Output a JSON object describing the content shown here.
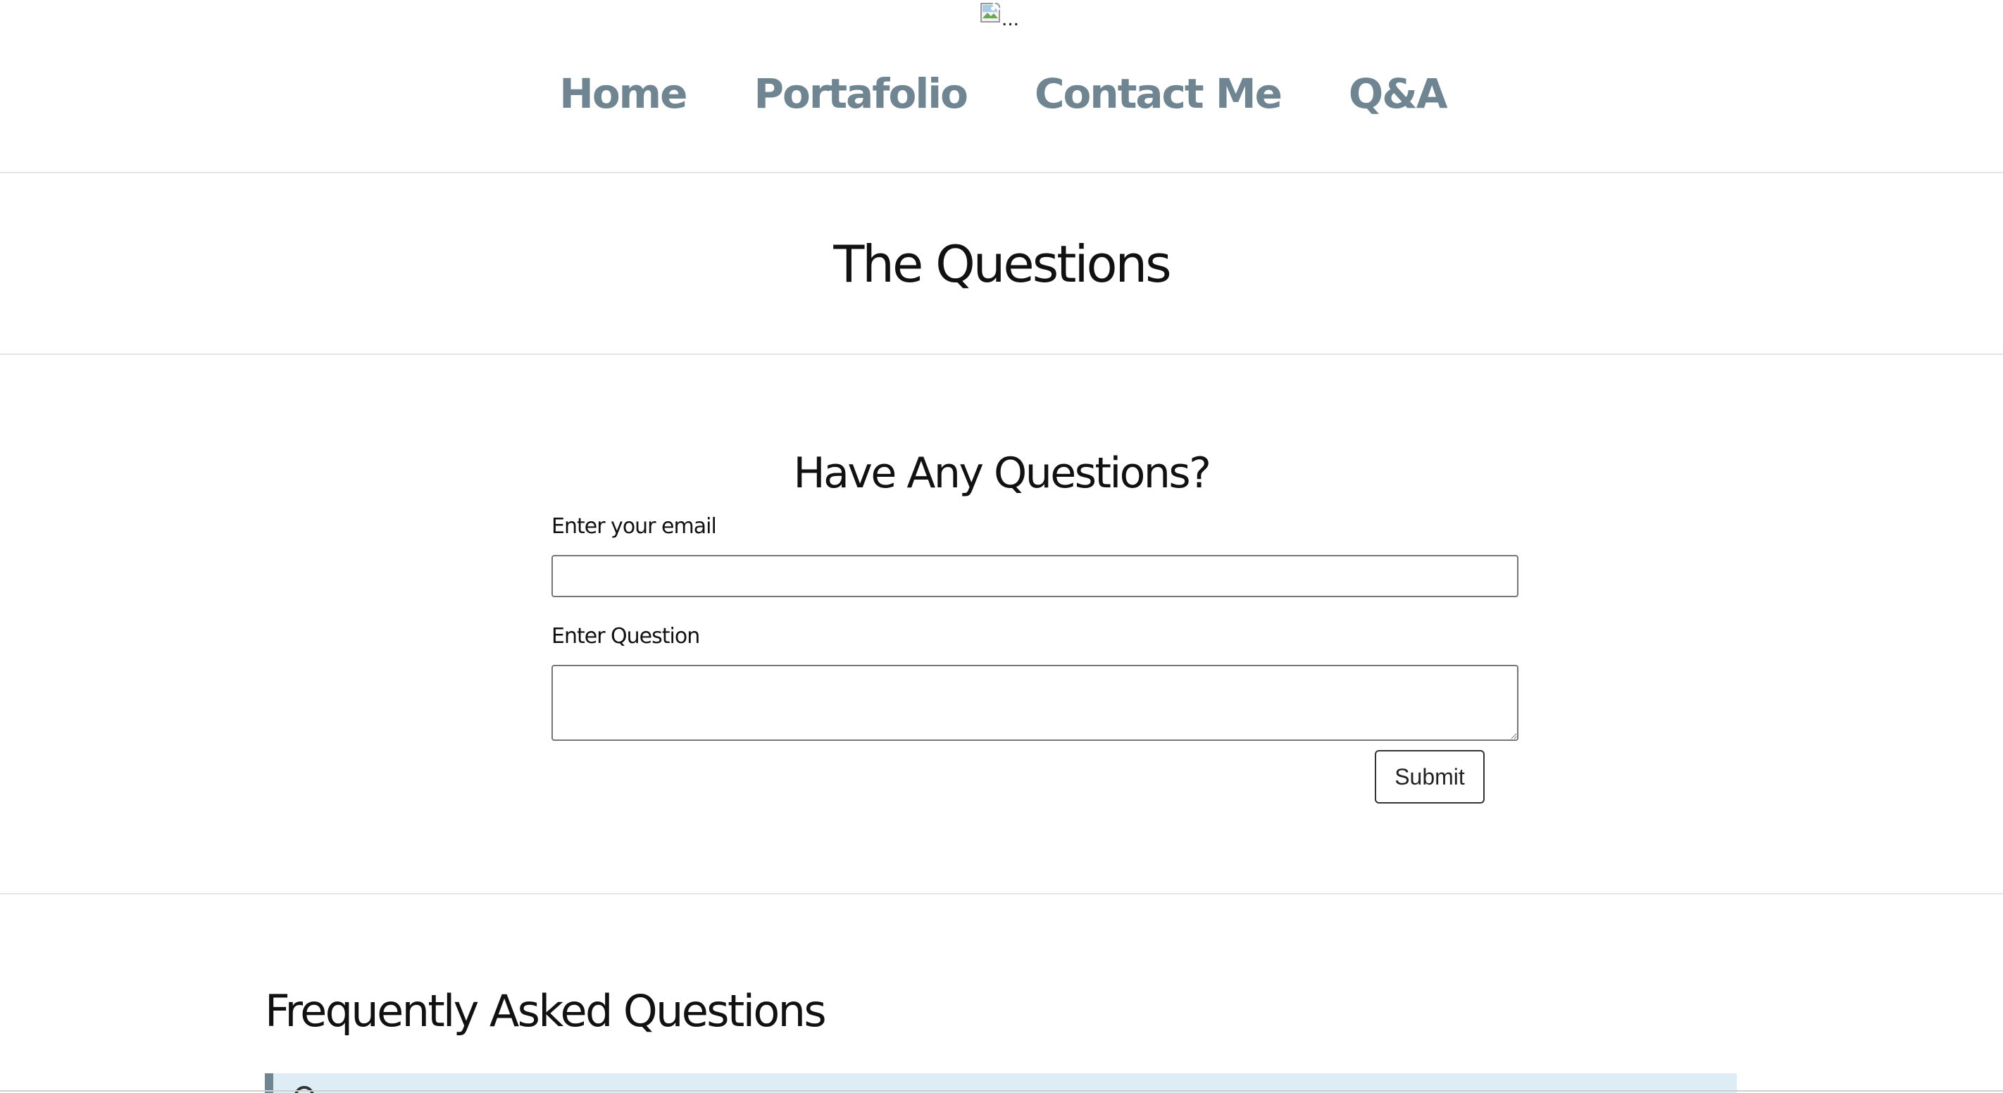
{
  "header": {
    "logo": {
      "alt_text": "...",
      "icon": "broken-image-icon"
    },
    "nav": {
      "items": [
        {
          "label": "Home"
        },
        {
          "label": "Portafolio"
        },
        {
          "label": "Contact Me"
        },
        {
          "label": "Q&A"
        }
      ]
    }
  },
  "page": {
    "title": "The Questions"
  },
  "question_form": {
    "heading": "Have Any Questions?",
    "email_label": "Enter your email",
    "email_value": "",
    "question_label": "Enter Question",
    "question_value": "",
    "submit_label": "Submit"
  },
  "faq": {
    "title": "Frequently Asked Questions"
  },
  "colors": {
    "nav_link": "#6f8591",
    "faq_item_background": "#deedf5",
    "faq_item_accent": "#6f8591",
    "divider": "#e4e4e4"
  }
}
